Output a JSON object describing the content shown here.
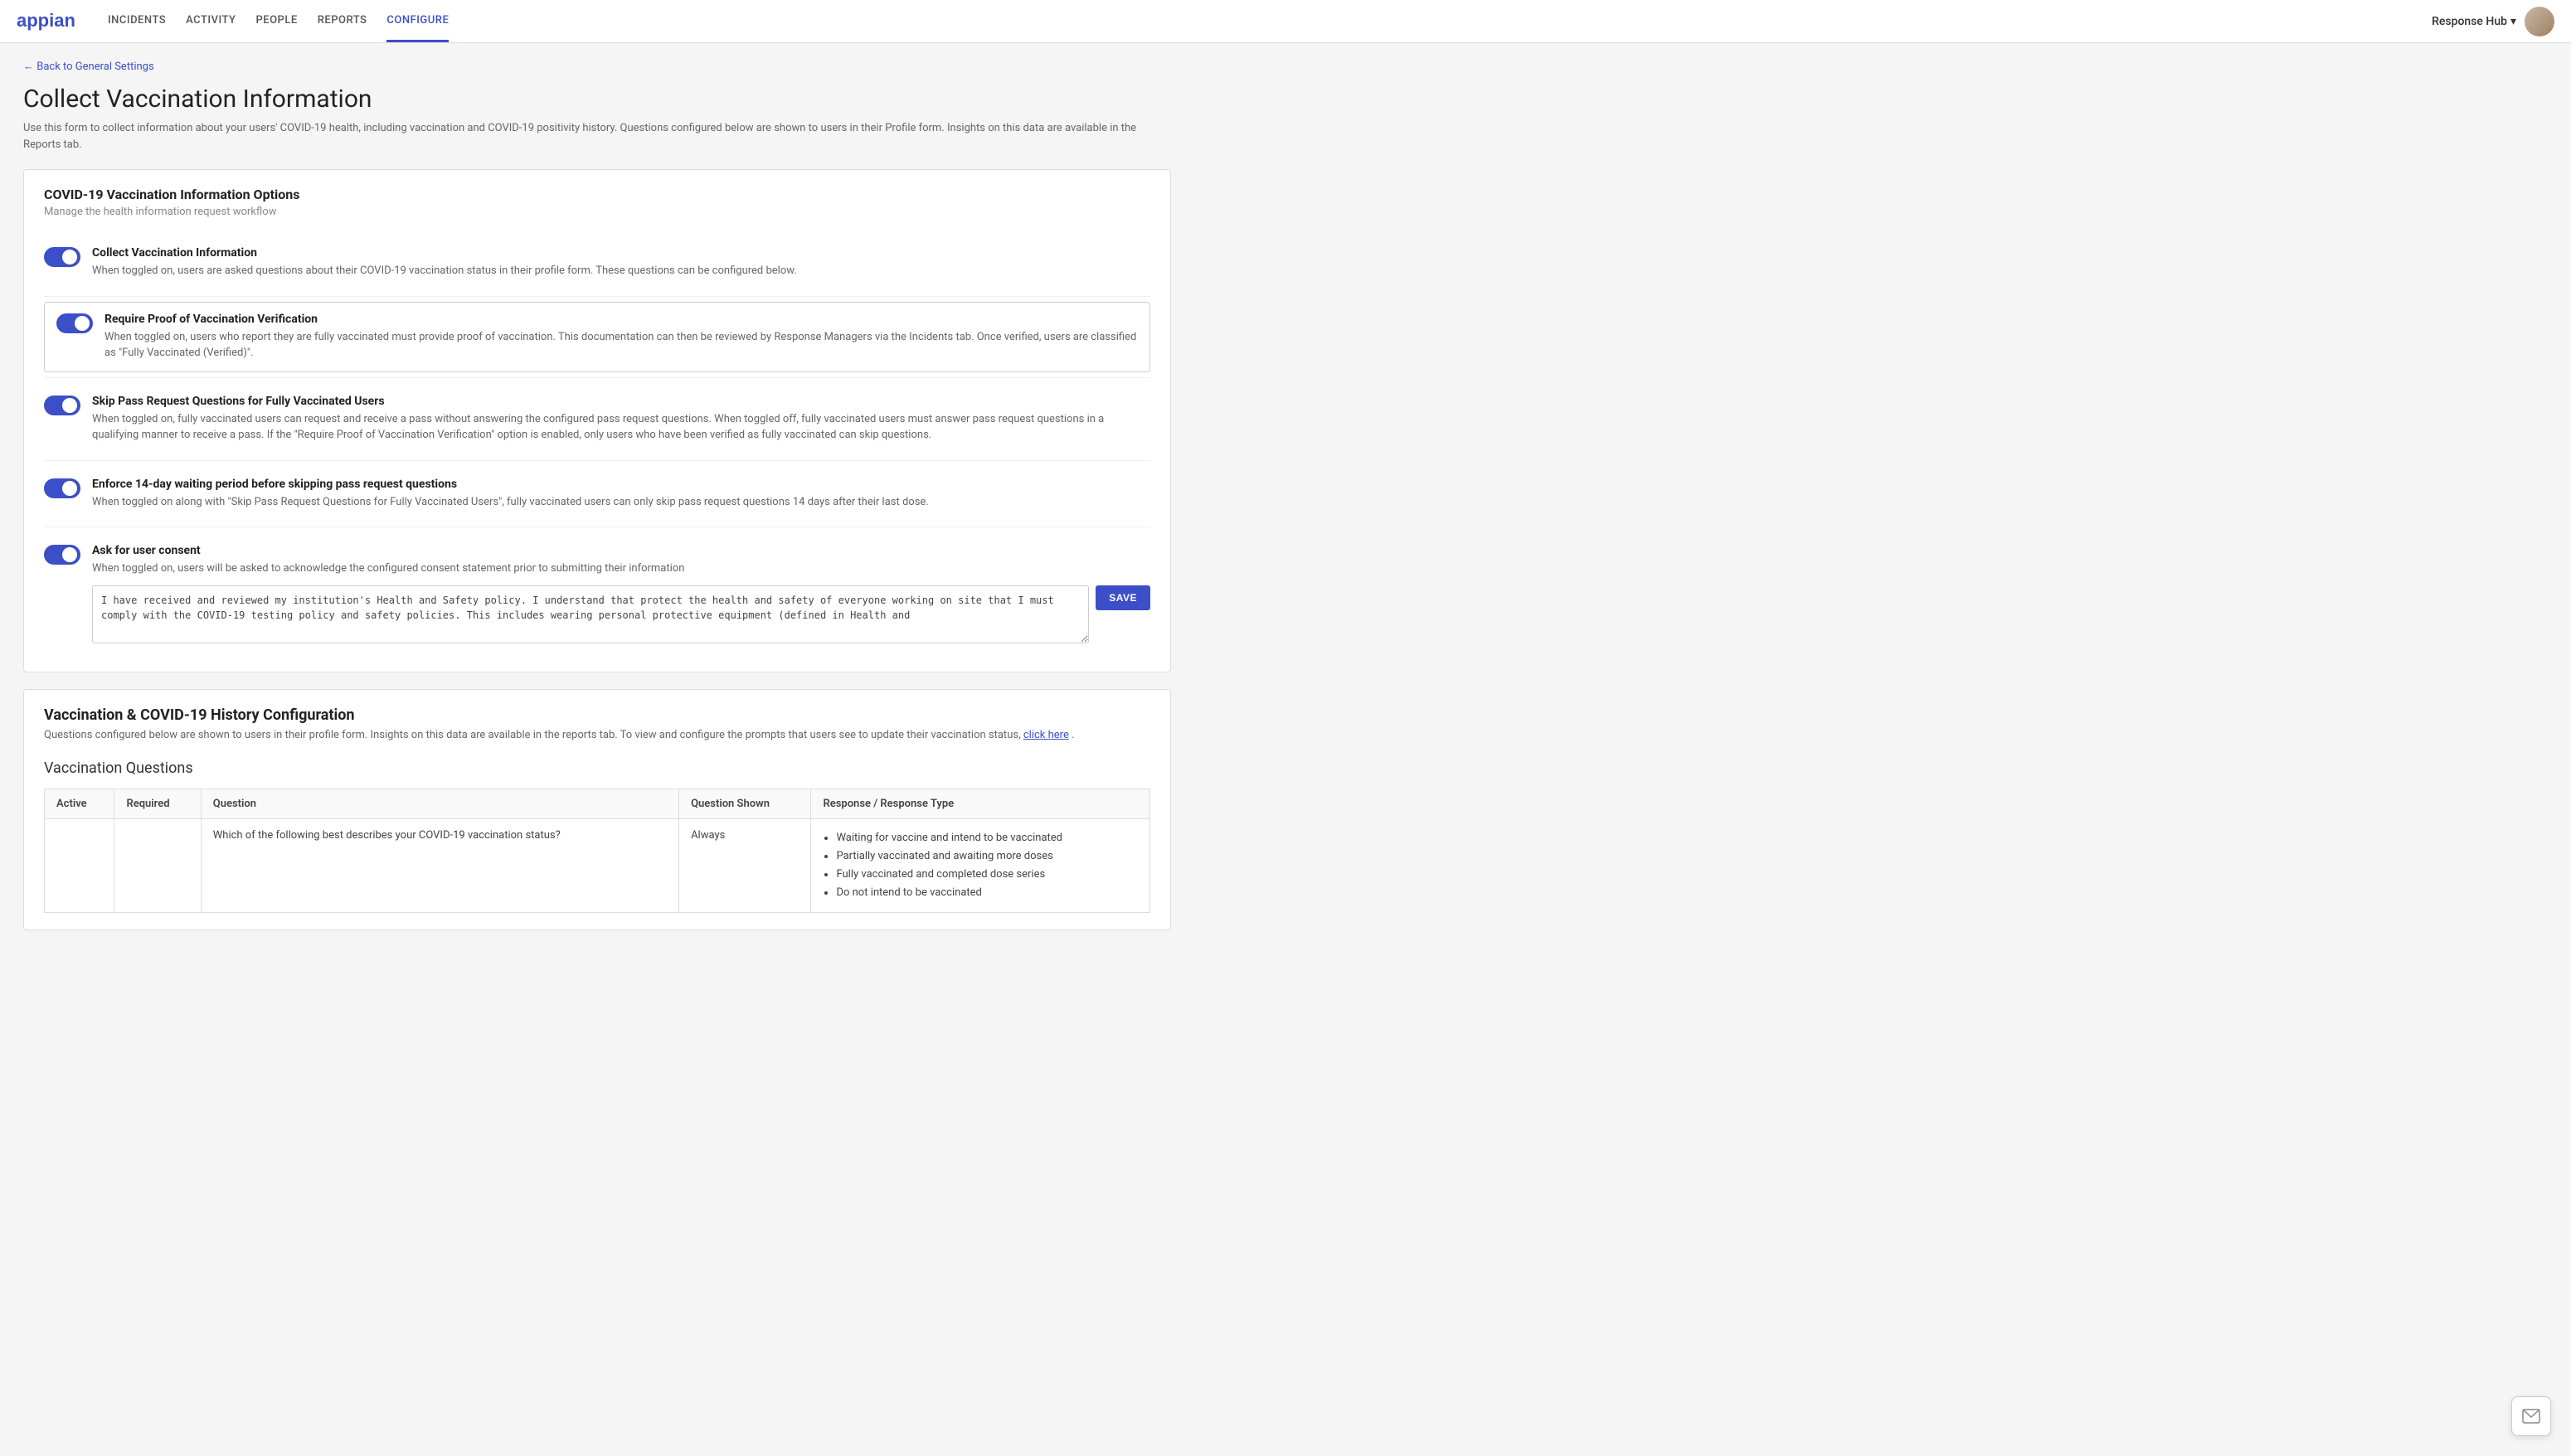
{
  "nav": {
    "logo_text": "appian",
    "links": [
      {
        "label": "INCIDENTS",
        "active": false
      },
      {
        "label": "ACTIVITY",
        "active": false
      },
      {
        "label": "PEOPLE",
        "active": false
      },
      {
        "label": "REPORTS",
        "active": false
      },
      {
        "label": "CONFIGURE",
        "active": true
      }
    ],
    "response_hub_label": "Response Hub",
    "dropdown_icon": "▾"
  },
  "page": {
    "back_label": "← Back to General Settings",
    "title": "Collect Vaccination Information",
    "subtitle": "Use this form to collect information about your users' COVID-19 health, including vaccination and COVID-19 positivity history. Questions configured below are shown to users in their Profile form. Insights on this data are available in the Reports tab."
  },
  "covid_section": {
    "title": "COVID-19 Vaccination Information Options",
    "desc": "Manage the health information request workflow",
    "toggles": [
      {
        "id": "toggle1",
        "label": "Collect Vaccination Information",
        "desc": "When toggled on, users are asked questions about their COVID-19 vaccination status in their profile form. These questions can be configured below.",
        "on": true,
        "highlighted": false
      },
      {
        "id": "toggle2",
        "label": "Require Proof of Vaccination Verification",
        "desc": "When toggled on, users who report they are fully vaccinated must provide proof of vaccination. This documentation can then be reviewed by Response Managers via the Incidents tab. Once verified, users are classified as \"Fully Vaccinated (Verified)\".",
        "on": true,
        "highlighted": true
      },
      {
        "id": "toggle3",
        "label": "Skip Pass Request Questions for Fully Vaccinated Users",
        "desc": "When toggled on, fully vaccinated users can request and receive a pass without answering the configured pass request questions. When toggled off, fully vaccinated users must answer pass request questions in a qualifying manner to receive a pass. If the \"Require Proof of Vaccination Verification\" option is enabled, only users who have been verified as fully vaccinated can skip questions.",
        "on": true,
        "highlighted": false
      },
      {
        "id": "toggle4",
        "label": "Enforce 14-day waiting period before skipping pass request questions",
        "desc": "When toggled on along with \"Skip Pass Request Questions for Fully Vaccinated Users\", fully vaccinated users can only skip pass request questions 14 days after their last dose.",
        "on": true,
        "highlighted": false
      },
      {
        "id": "toggle5",
        "label": "Ask for user consent",
        "desc": "When toggled on, users will be asked to acknowledge the configured consent statement prior to submitting their information",
        "on": true,
        "highlighted": false
      }
    ],
    "consent_text": "I have received and reviewed my institution's Health and Safety policy. I understand that protect the health and safety of everyone working on site that I must comply with the COVID-19 testing policy and safety policies. This includes wearing personal protective equipment (defined in Health and",
    "save_label": "SAVE"
  },
  "vacc_section": {
    "title": "Vaccination & COVID-19 History Configuration",
    "desc_before": "Questions configured below are shown to users in their profile form. Insights on this data are available in the reports tab. To view and configure the prompts that users see to update their vaccination status,",
    "click_here_label": "click here",
    "desc_after": ".",
    "questions_title": "Vaccination Questions",
    "table": {
      "columns": [
        "Active",
        "Required",
        "Question",
        "Question Shown",
        "Response / Response Type"
      ],
      "rows": [
        {
          "active": false,
          "required": true,
          "question": "Which of the following best describes your COVID-19 vaccination status?",
          "question_shown": "Always",
          "responses": [
            "Waiting for vaccine and intend to be vaccinated",
            "Partially vaccinated and awaiting more doses",
            "Fully vaccinated and completed dose series",
            "Do not intend to be vaccinated"
          ]
        }
      ]
    }
  },
  "help_btn_label": "?"
}
